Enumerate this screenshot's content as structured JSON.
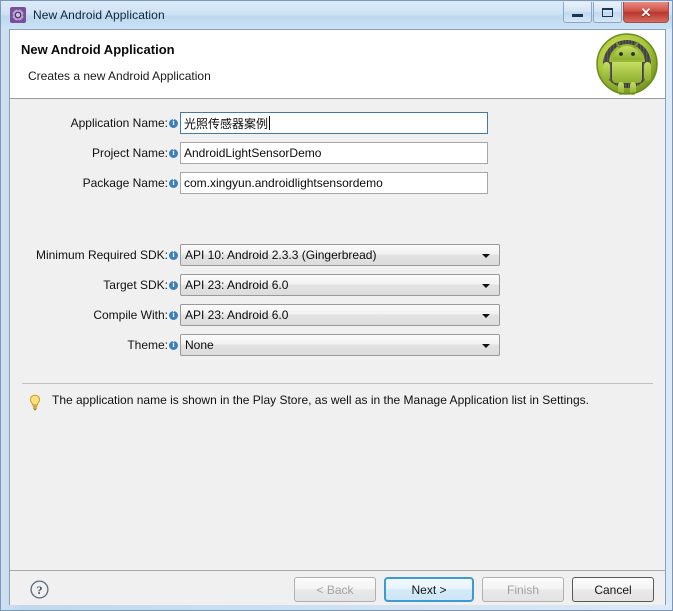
{
  "window": {
    "title": "New Android Application",
    "icon": "gear-icon",
    "controls": {
      "minimize": "minimize-icon",
      "maximize": "maximize-icon",
      "close": "✕"
    }
  },
  "header": {
    "title": "New Android Application",
    "subtitle": "Creates a new Android Application",
    "logo": "android-robot-logo"
  },
  "form": {
    "text_fields": [
      {
        "label": "Application Name:",
        "value": "光照传感器案例",
        "focused": true,
        "name": "application-name"
      },
      {
        "label": "Project Name:",
        "value": "AndroidLightSensorDemo",
        "focused": false,
        "name": "project-name"
      },
      {
        "label": "Package Name:",
        "value": "com.xingyun.androidlightsensordemo",
        "focused": false,
        "name": "package-name"
      }
    ],
    "combos": [
      {
        "label": "Minimum Required SDK:",
        "value": "API 10: Android 2.3.3 (Gingerbread)",
        "name": "minimum-required-sdk"
      },
      {
        "label": "Target SDK:",
        "value": "API 23: Android 6.0",
        "name": "target-sdk"
      },
      {
        "label": "Compile With:",
        "value": "API 23: Android 6.0",
        "name": "compile-with"
      },
      {
        "label": "Theme:",
        "value": "None",
        "name": "theme"
      }
    ]
  },
  "hint": {
    "icon": "lightbulb-icon",
    "text": "The application name is shown in the Play Store, as well as in the Manage Application list in Settings."
  },
  "footer": {
    "help_icon": "help-question-icon",
    "buttons": [
      {
        "label": "< Back",
        "state": "disabled"
      },
      {
        "label": "Next >",
        "state": "default-focused"
      },
      {
        "label": "Finish",
        "state": "disabled"
      },
      {
        "label": "Cancel",
        "state": "enabled"
      }
    ]
  },
  "colors": {
    "titlebar": "#cfe3f5",
    "dialog_bg": "#f0f0f0",
    "accent_focus": "#3c9ad4",
    "info_icon": "#3b7fbd",
    "android_green": "#a4c639",
    "close_red": "#cf5146"
  }
}
